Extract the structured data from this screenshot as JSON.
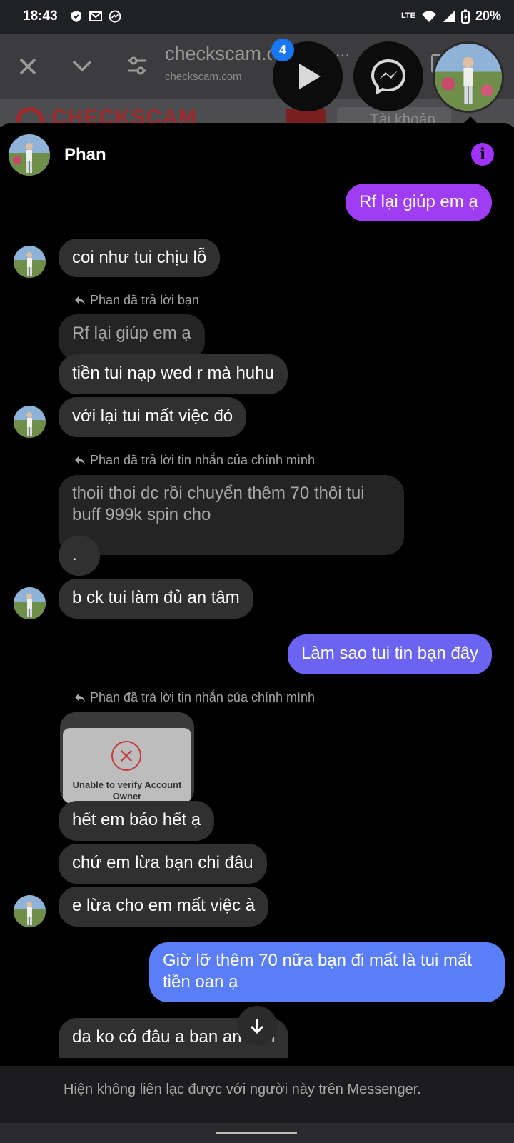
{
  "status_bar": {
    "time": "18:43",
    "battery": "20%",
    "network": "LTE"
  },
  "browser": {
    "page_title": "checkscam.c",
    "url": "checkscam.com",
    "more": "..."
  },
  "web_page": {
    "logo_text": "CHECKSCAM",
    "search_placeholder": "Tài khoản"
  },
  "chat_heads": {
    "unread_count": "4"
  },
  "chat": {
    "contact_name": "Phan",
    "messages": [
      {
        "text": "Rf lại giúp em ạ"
      },
      {
        "text": "coi như tui chịu lỗ"
      },
      {
        "reply_note": "Phan đã trả lời bạn"
      },
      {
        "text": "Rf lại giúp em ạ"
      },
      {
        "text": "tiền tui nạp wed r mà huhu"
      },
      {
        "text": "với lại tui mất việc đó"
      },
      {
        "reply_note": "Phan đã trả lời tin nhắn của chính mình"
      },
      {
        "text_line1": "thoii thoi dc rồi chuyển thêm 70 thôi tui",
        "text_line2": "buff 999k spin cho"
      },
      {
        "text": "."
      },
      {
        "text": "b ck tui làm đủ an tâm"
      },
      {
        "text": "Làm sao tui tin bạn đây"
      },
      {
        "reply_note": "Phan đã trả lời tin nhắn của chính mình"
      },
      {
        "image_caption_line1": "Unable to verify Account",
        "image_caption_line2": "Owner"
      },
      {
        "text": "hết em báo hết ạ"
      },
      {
        "text": "chứ em lừa bạn chi đâu"
      },
      {
        "text": "e lừa cho em mất việc à"
      },
      {
        "text_line1": "Giờ lỡ thêm 70 nữa bạn đi mất là tui mất",
        "text_line2": "tiền oan ạ"
      },
      {
        "text": "da ko có đâu a ban an tâm"
      }
    ],
    "footer_notice": "Hiện không liên lạc được với người này trên Messenger."
  },
  "colors": {
    "outgoing_purple": "#9e3df2",
    "outgoing_blue": "#6b63f2",
    "outgoing_blue2": "#5a7ef7",
    "info_button": "#a033ff",
    "badge": "#1877f2"
  },
  "icons": [
    "close-icon",
    "chevron-down-icon",
    "tune-icon",
    "play-icon",
    "messenger-icon",
    "info-icon",
    "reply-arrow-icon",
    "error-x-icon",
    "arrow-down-icon",
    "shield-icon",
    "gmail-icon",
    "messenger-notif-icon",
    "wifi-icon",
    "signal-icon",
    "battery-icon"
  ]
}
